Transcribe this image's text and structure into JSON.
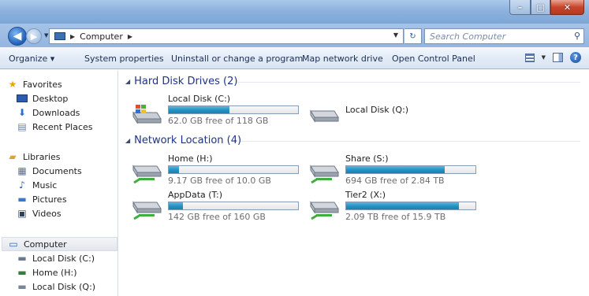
{
  "window": {
    "controls": [
      "minimize",
      "maximize",
      "close"
    ]
  },
  "address": {
    "path": "Computer",
    "search_placeholder": "Search Computer"
  },
  "commands": {
    "organize": "Organize ▾",
    "system_properties": "System properties",
    "uninstall": "Uninstall or change a program",
    "map_drive": "Map network drive",
    "control_panel": "Open Control Panel"
  },
  "nav": {
    "favorites": "Favorites",
    "desktop": "Desktop",
    "downloads": "Downloads",
    "recent": "Recent Places",
    "libraries": "Libraries",
    "documents": "Documents",
    "music": "Music",
    "pictures": "Pictures",
    "videos": "Videos",
    "computer": "Computer",
    "local_c": "Local Disk (C:)",
    "home_h": "Home (H:)",
    "local_q": "Local Disk (Q:)"
  },
  "groups": {
    "hdd": "Hard Disk Drives (2)",
    "net": "Network Location (4)"
  },
  "drives": {
    "c": {
      "name": "Local Disk (C:)",
      "free": "62.0 GB free of 118 GB",
      "used_fraction": 0.47
    },
    "q": {
      "name": "Local Disk (Q:)"
    },
    "h": {
      "name": "Home (H:)",
      "free": "9.17 GB free of 10.0 GB",
      "used_fraction": 0.08
    },
    "s": {
      "name": "Share (S:)",
      "free": "694 GB free of 2.84 TB",
      "used_fraction": 0.76
    },
    "t": {
      "name": "AppData (T:)",
      "free": "142 GB free of 160 GB",
      "used_fraction": 0.11
    },
    "x": {
      "name": "Tier2 (X:)",
      "free": "2.09 TB free of 15.9 TB",
      "used_fraction": 0.87
    }
  },
  "colors": {
    "titlebar": "#8db2de",
    "bar_fill": "#2593c4",
    "group_heading": "#1e3287"
  }
}
